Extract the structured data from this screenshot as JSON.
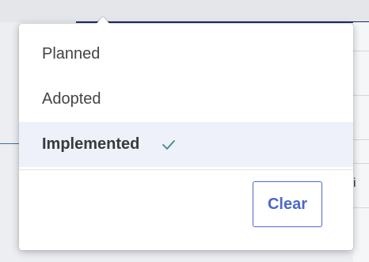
{
  "background": {
    "peek_text": "i"
  },
  "dropdown": {
    "options": [
      {
        "label": "Planned",
        "selected": false
      },
      {
        "label": "Adopted",
        "selected": false
      },
      {
        "label": "Implemented",
        "selected": true
      }
    ],
    "check_icon": "checkmark-icon",
    "clear_label": "Clear"
  },
  "colors": {
    "accent": "#4c68c9",
    "check": "#3c8c8c",
    "selected_bg": "#eef1fa",
    "navy_line": "#1f2a66"
  }
}
